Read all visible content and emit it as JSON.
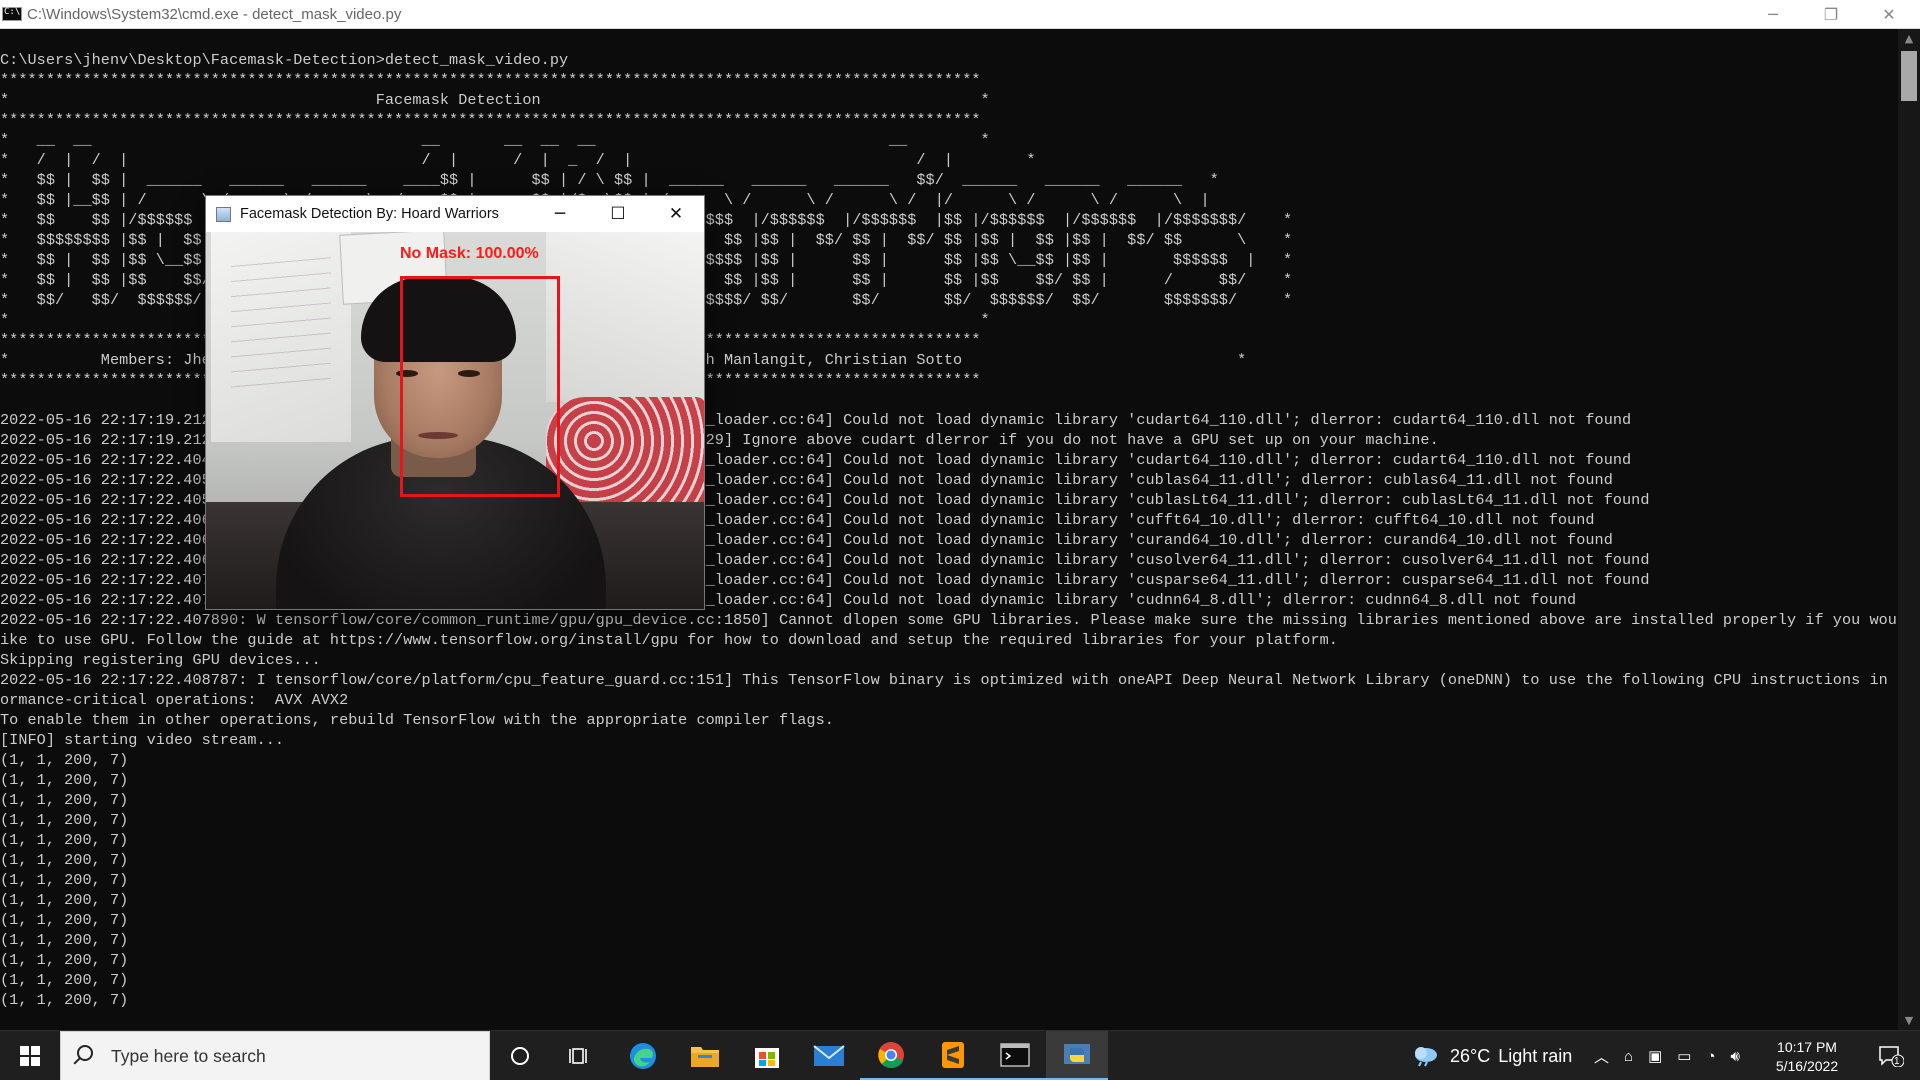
{
  "window": {
    "title": "C:\\Windows\\System32\\cmd.exe - detect_mask_video.py",
    "minimize": "─",
    "restore": "❐",
    "close": "✕"
  },
  "console": {
    "lines": [
      "C:\\Users\\jhenv\\Desktop\\Facemask-Detection>detect_mask_video.py",
      "***********************************************************************************************************",
      "*                                        Facemask Detection                                                *",
      "***********************************************************************************************************",
      "*   __  __                                    __       __  __  __                                __        *",
      "*   /  |  /  |                                /  |      /  |  _  /  |                               /  |        *",
      "*   $$ |  $$ |  ______   ______   ______    ____$$ |      $$ | / \\ $$ |  ______   ______   ______   $$/  ______   ______   ______   *",
      "*   $$ |__$$ | /      \\ /      \\ /      \\  /    $$ |      $$ |/$  \\$$ | /      \\ /      \\ /      \\ /  |/      \\ /      \\ /      \\  |",
      "*   $$    $$ |/$$$$$$  |/$$$$$$  |/$$$$$$  |/$$$$$$$ |      $$ /$$$  $$ | $$$$$$  |/$$$$$$  |/$$$$$$  |$$ |/$$$$$$  |/$$$$$$  |/$$$$$$$/    *",
      "*   $$$$$$$$ |$$ |  $$ |$$ |  $$ |$$ |  $$ |$$ |  $$ |      $$ $$/$$ $$ | /    $$ |$$ |  $$/ $$ |  $$/ $$ |$$ |  $$ |$$ |  $$/ $$      \\    *",
      "*   $$ |  $$ |$$ \\__$$ |$$ \\__$$ |$$ |      $$ \\__$$ |      $$$$/  $$$$ |/$$$$$$$ |$$ |      $$ |      $$ |$$ \\__$$ |$$ |       $$$$$$  |   *",
      "*   $$ |  $$ |$$    $$/ $$    $$ |$$ |      $$    $$ |      $$$/    $$$ |$$    $$ |$$ |      $$ |      $$ |$$    $$/ $$ |      /     $$/    *",
      "*   $$/   $$/  $$$$$$/   $$$$$$$/ $$/        $$$$$$$/       $$/      $$/  $$$$$$$/ $$/       $$/       $$/  $$$$$$/  $$/       $$$$$$$/     *",
      "*                                                                                                          *",
      "***********************************************************************************************************",
      "*          Members: Jhenver Sorilla, Mark Aldrin, Christopher Gonzales, Joseph Manlangit, Christian Sotto                              *",
      "***********************************************************************************************************",
      "",
      "2022-05-16 22:17:19.212934: W tensorflow/stream_executor/platform/default/dso_loader.cc:64] Could not load dynamic library 'cudart64_110.dll'; dlerror: cudart64_110.dll not found",
      "2022-05-16 22:17:19.212974: I tensorflow/stream_executor/cuda/cudart_stub.cc:29] Ignore above cudart dlerror if you do not have a GPU set up on your machine.",
      "2022-05-16 22:17:22.404652: W tensorflow/stream_executor/platform/default/dso_loader.cc:64] Could not load dynamic library 'cudart64_110.dll'; dlerror: cudart64_110.dll not found",
      "2022-05-16 22:17:22.405123: W tensorflow/stream_executor/platform/default/dso_loader.cc:64] Could not load dynamic library 'cublas64_11.dll'; dlerror: cublas64_11.dll not found",
      "2022-05-16 22:17:22.405587: W tensorflow/stream_executor/platform/default/dso_loader.cc:64] Could not load dynamic library 'cublasLt64_11.dll'; dlerror: cublasLt64_11.dll not found",
      "2022-05-16 22:17:22.406019: W tensorflow/stream_executor/platform/default/dso_loader.cc:64] Could not load dynamic library 'cufft64_10.dll'; dlerror: cufft64_10.dll not found",
      "2022-05-16 22:17:22.406458: W tensorflow/stream_executor/platform/default/dso_loader.cc:64] Could not load dynamic library 'curand64_10.dll'; dlerror: curand64_10.dll not found",
      "2022-05-16 22:17:22.406901: W tensorflow/stream_executor/platform/default/dso_loader.cc:64] Could not load dynamic library 'cusolver64_11.dll'; dlerror: cusolver64_11.dll not found",
      "2022-05-16 22:17:22.407344: W tensorflow/stream_executor/platform/default/dso_loader.cc:64] Could not load dynamic library 'cusparse64_11.dll'; dlerror: cusparse64_11.dll not found",
      "2022-05-16 22:17:22.407782: W tensorflow/stream_executor/platform/default/dso_loader.cc:64] Could not load dynamic library 'cudnn64_8.dll'; dlerror: cudnn64_8.dll not found",
      "2022-05-16 22:17:22.407890: W tensorflow/core/common_runtime/gpu/gpu_device.cc:1850] Cannot dlopen some GPU libraries. Please make sure the missing libraries mentioned above are installed properly if you would l",
      "ike to use GPU. Follow the guide at https://www.tensorflow.org/install/gpu for how to download and setup the required libraries for your platform.",
      "Skipping registering GPU devices...",
      "2022-05-16 22:17:22.408787: I tensorflow/core/platform/cpu_feature_guard.cc:151] This TensorFlow binary is optimized with oneAPI Deep Neural Network Library (oneDNN) to use the following CPU instructions in perf",
      "ormance-critical operations:  AVX AVX2",
      "To enable them in other operations, rebuild TensorFlow with the appropriate compiler flags.",
      "[INFO] starting video stream...",
      "(1, 1, 200, 7)",
      "(1, 1, 200, 7)",
      "(1, 1, 200, 7)",
      "(1, 1, 200, 7)",
      "(1, 1, 200, 7)",
      "(1, 1, 200, 7)",
      "(1, 1, 200, 7)",
      "(1, 1, 200, 7)",
      "(1, 1, 200, 7)",
      "(1, 1, 200, 7)",
      "(1, 1, 200, 7)",
      "(1, 1, 200, 7)",
      "(1, 1, 200, 7)"
    ]
  },
  "video_window": {
    "title": "Facemask Detection By: Hoard Warriors",
    "minimize": "─",
    "maximize": "☐",
    "close": "✕",
    "detection_label": "No Mask: 100.00%",
    "box_color": "#e8141c"
  },
  "taskbar": {
    "search_placeholder": "Type here to search",
    "icons": [
      "windows-start-icon",
      "cortana-icon",
      "task-view-icon",
      "edge-icon",
      "file-explorer-icon",
      "microsoft-store-icon",
      "mail-icon",
      "chrome-icon",
      "sublime-text-icon",
      "cmd-icon",
      "python-icon"
    ],
    "weather_temp": "26°C",
    "weather_desc": "Light rain",
    "time": "10:17 PM",
    "date": "5/16/2022",
    "notification_count": "1"
  }
}
